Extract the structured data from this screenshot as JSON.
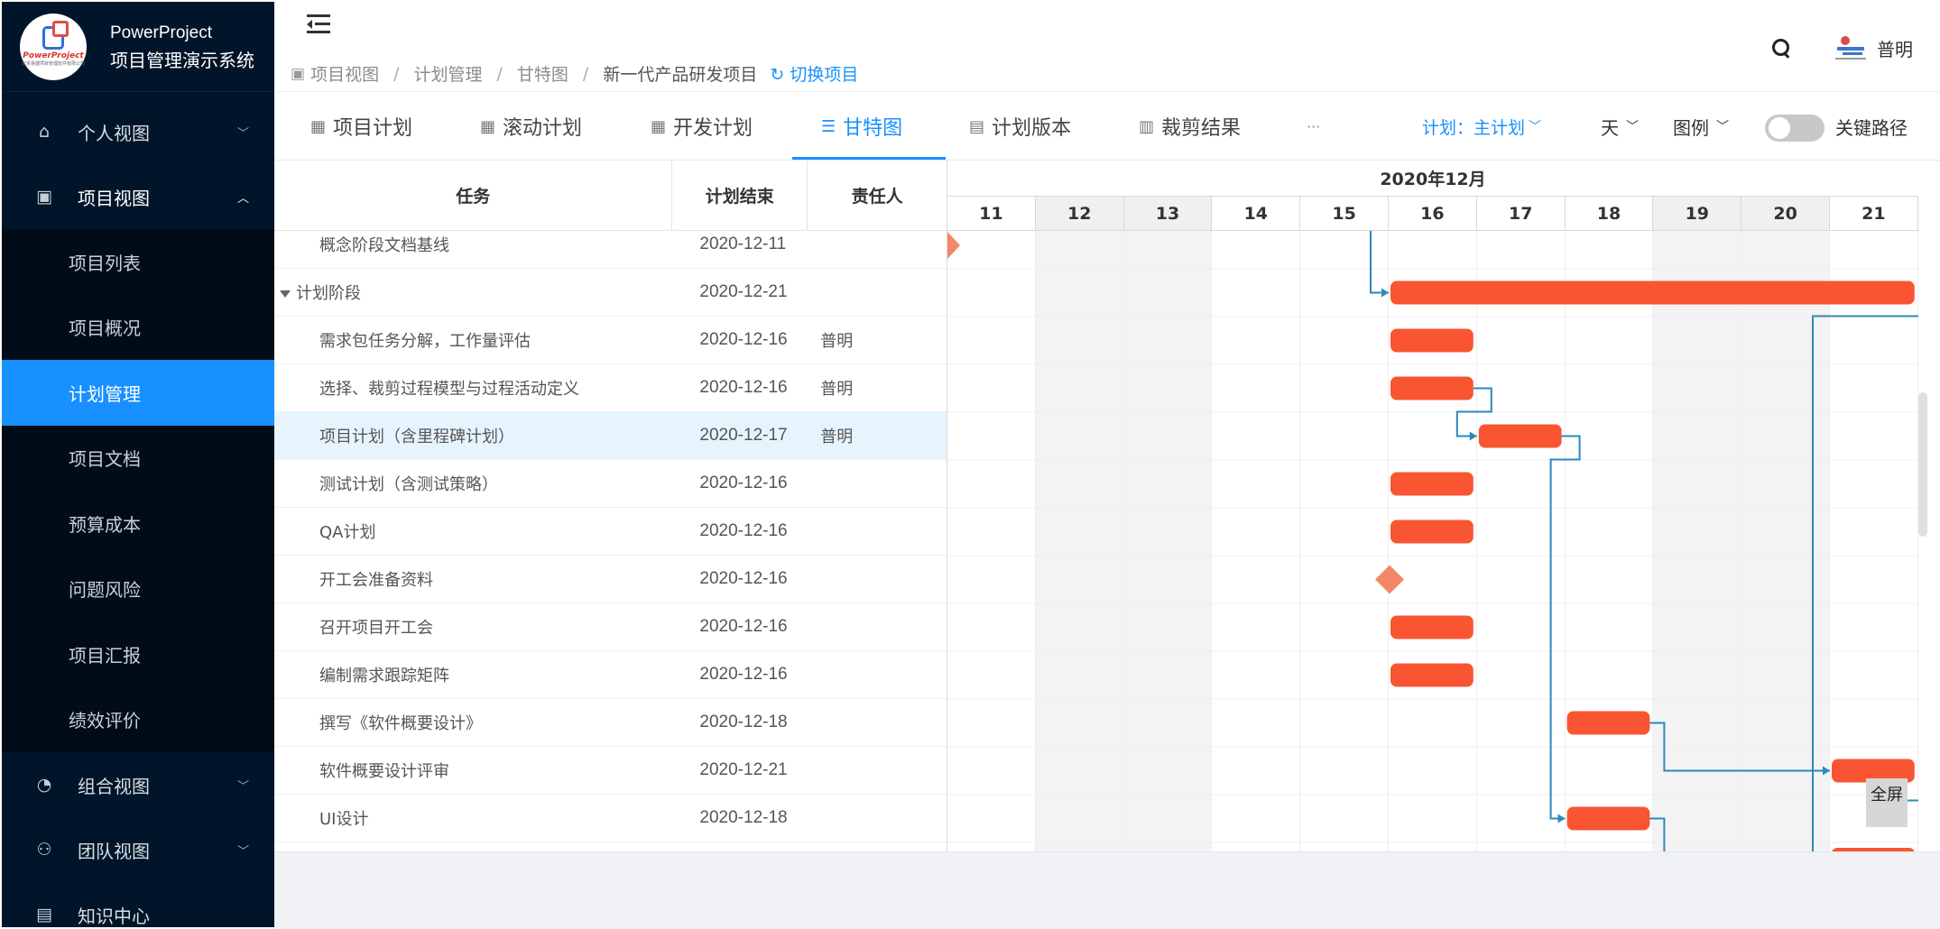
{
  "brand": {
    "logo_text": "PowerProject",
    "logo_sub": "北京易捷项目管理软件有限公司",
    "name_en": "PowerProject",
    "name_cn": "项目管理演示系统"
  },
  "sidebar": {
    "groups": [
      {
        "label": "个人视图",
        "icon": "home-icon",
        "open": false
      },
      {
        "label": "项目视图",
        "icon": "project-icon",
        "open": true
      },
      {
        "label": "组合视图",
        "icon": "dashboard-icon",
        "open": false
      },
      {
        "label": "团队视图",
        "icon": "team-icon",
        "open": false
      },
      {
        "label": "知识中心",
        "icon": "knowledge-icon",
        "open": false
      }
    ],
    "project_items": [
      "项目列表",
      "项目概况",
      "计划管理",
      "项目文档",
      "预算成本",
      "问题风险",
      "项目汇报",
      "绩效评价"
    ],
    "active_item": "计划管理"
  },
  "header": {
    "breadcrumb": [
      "项目视图",
      "计划管理",
      "甘特图",
      "新一代产品研发项目"
    ],
    "switch_label": "切换项目",
    "user_name": "普明"
  },
  "tabs": {
    "items": [
      {
        "label": "项目计划",
        "icon": "calendar-icon"
      },
      {
        "label": "滚动计划",
        "icon": "calendar-icon"
      },
      {
        "label": "开发计划",
        "icon": "calendar-icon"
      },
      {
        "label": "甘特图",
        "icon": "gantt-icon"
      },
      {
        "label": "计划版本",
        "icon": "version-icon"
      },
      {
        "label": "裁剪结果",
        "icon": "cut-icon"
      }
    ],
    "active": "甘特图",
    "more": "···",
    "plan_select": "计划：主计划",
    "scale_select": "天",
    "legend_select": "图例",
    "critical_path_label": "关键路径",
    "critical_path_on": false
  },
  "grid": {
    "columns": [
      "任务",
      "计划结束",
      "责任人"
    ],
    "partial_row": {
      "task": "概念阶段文档基线",
      "end": "2020-12-11",
      "owner": ""
    },
    "rows": [
      {
        "task": "计划阶段",
        "end": "2020-12-21",
        "owner": "",
        "group": true
      },
      {
        "task": "需求包任务分解，工作量评估",
        "end": "2020-12-16",
        "owner": "普明"
      },
      {
        "task": "选择、裁剪过程模型与过程活动定义",
        "end": "2020-12-16",
        "owner": "普明"
      },
      {
        "task": "项目计划（含里程碑计划）",
        "end": "2020-12-17",
        "owner": "普明",
        "highlight": true
      },
      {
        "task": "测试计划（含测试策略）",
        "end": "2020-12-16",
        "owner": ""
      },
      {
        "task": "QA计划",
        "end": "2020-12-16",
        "owner": ""
      },
      {
        "task": "开工会准备资料",
        "end": "2020-12-16",
        "owner": ""
      },
      {
        "task": "召开项目开工会",
        "end": "2020-12-16",
        "owner": ""
      },
      {
        "task": "编制需求跟踪矩阵",
        "end": "2020-12-16",
        "owner": ""
      },
      {
        "task": "撰写《软件概要设计》",
        "end": "2020-12-18",
        "owner": ""
      },
      {
        "task": "软件概要设计评审",
        "end": "2020-12-21",
        "owner": ""
      },
      {
        "task": "UI设计",
        "end": "2020-12-18",
        "owner": ""
      }
    ]
  },
  "chart_data": {
    "type": "gantt",
    "month_label": "2020年12月",
    "days": [
      "11",
      "12",
      "13",
      "14",
      "15",
      "16",
      "17",
      "18",
      "19",
      "20",
      "21"
    ],
    "weekend_days": [
      "12",
      "13",
      "19",
      "20"
    ],
    "bars": [
      {
        "task": "概念阶段文档基线",
        "kind": "milestone",
        "day": "11"
      },
      {
        "task": "计划阶段",
        "kind": "bar",
        "start": "16",
        "end": "21"
      },
      {
        "task": "需求包任务分解，工作量评估",
        "kind": "bar",
        "start": "16",
        "end": "16"
      },
      {
        "task": "选择、裁剪过程模型与过程活动定义",
        "kind": "bar",
        "start": "16",
        "end": "16"
      },
      {
        "task": "项目计划（含里程碑计划）",
        "kind": "bar",
        "start": "17",
        "end": "17"
      },
      {
        "task": "测试计划（含测试策略）",
        "kind": "bar",
        "start": "16",
        "end": "16"
      },
      {
        "task": "QA计划",
        "kind": "bar",
        "start": "16",
        "end": "16"
      },
      {
        "task": "开工会准备资料",
        "kind": "milestone",
        "day": "16"
      },
      {
        "task": "召开项目开工会",
        "kind": "bar",
        "start": "16",
        "end": "16"
      },
      {
        "task": "编制需求跟踪矩阵",
        "kind": "bar",
        "start": "16",
        "end": "16"
      },
      {
        "task": "撰写《软件概要设计》",
        "kind": "bar",
        "start": "18",
        "end": "18"
      },
      {
        "task": "软件概要设计评审",
        "kind": "bar",
        "start": "21",
        "end": "21"
      },
      {
        "task": "UI设计",
        "kind": "bar",
        "start": "18",
        "end": "18"
      }
    ],
    "bar_color": "#fa5533",
    "milestone_color": "#f4876a",
    "link_color": "#2a8ab8"
  },
  "fullscreen_label": "全屏"
}
